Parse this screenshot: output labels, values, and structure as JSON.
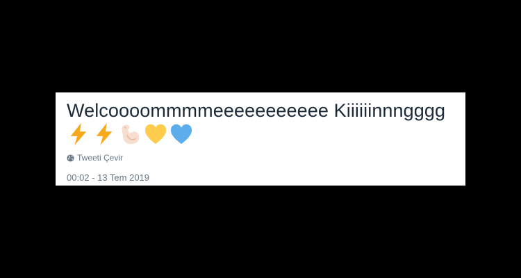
{
  "tweet": {
    "text": "Welcoooommmmeeeeeeeeeee Kiiiiiinnngggg",
    "emojis": [
      "lightning-icon",
      "lightning-icon",
      "flexed-biceps-icon",
      "yellow-heart-icon",
      "blue-heart-icon"
    ],
    "translate_label": "Tweeti Çevir",
    "timestamp": "00:02 - 13 Tem 2019"
  },
  "colors": {
    "background": "#000000",
    "card": "#ffffff",
    "text": "#1c2938",
    "secondary": "#657786",
    "lightning": "#f8a81b",
    "yellow_heart": "#ffcc4d",
    "blue_heart": "#5dadec",
    "arm": "#f7dece"
  }
}
